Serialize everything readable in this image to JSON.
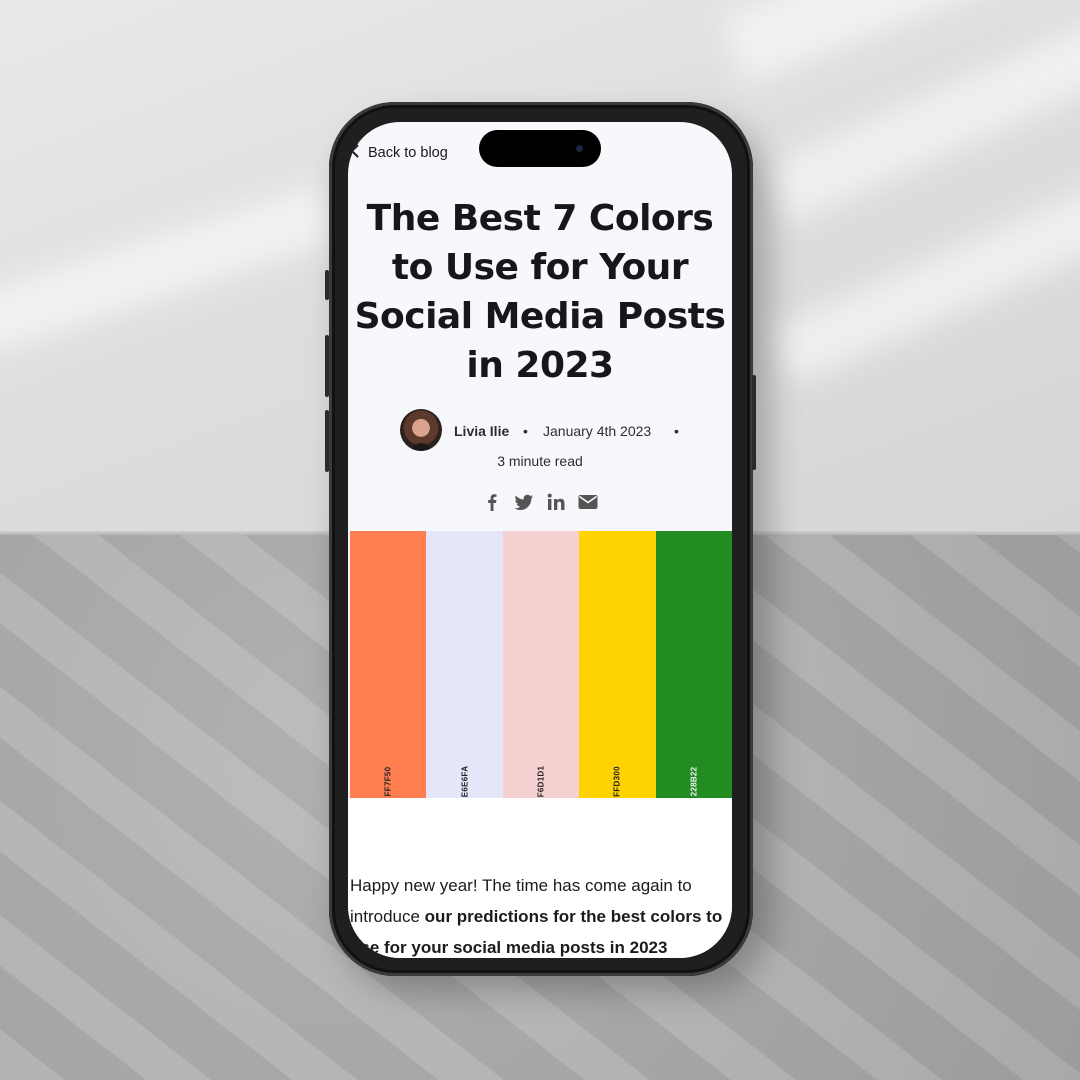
{
  "nav": {
    "back_label": "Back to blog"
  },
  "post": {
    "title_lines": [
      "The Best 7 Colors",
      "to Use for Your",
      "Social Media Posts",
      "in 2023"
    ],
    "author": "Livia Ilie",
    "date": "January 4th 2023",
    "read_time": "3 minute read",
    "share_icons": [
      "facebook-icon",
      "twitter-icon",
      "linkedin-icon",
      "email-icon"
    ]
  },
  "palette": [
    {
      "code": "FF7F50",
      "color": "#FF7F50"
    },
    {
      "code": "E6E6FA",
      "color": "#E6E6FA"
    },
    {
      "code": "F6D1D1",
      "color": "#F6D1D1"
    },
    {
      "code": "FFD300",
      "color": "#FFD300"
    },
    {
      "code": "228B22",
      "color": "#228B22"
    }
  ],
  "article": {
    "intro_plain": "Happy new year! The time has come again to introduce ",
    "intro_bold": "our predictions for the best colors to use for your social media posts in 2023"
  }
}
